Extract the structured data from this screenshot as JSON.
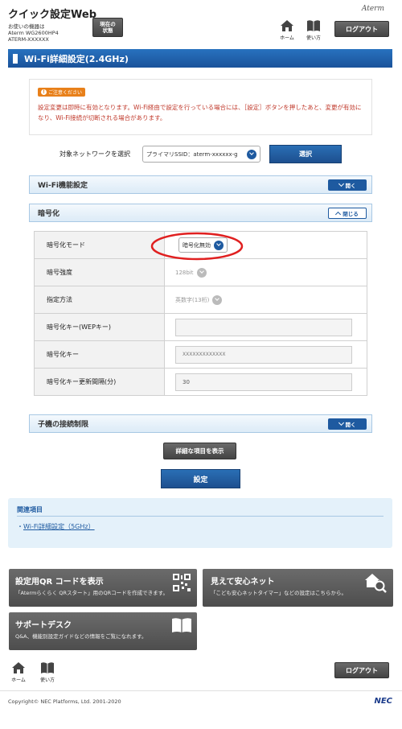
{
  "header": {
    "title": "クイック設定Web",
    "device_label": "お使いの機器は",
    "device_model": "Aterm WG2600HP4",
    "device_name": "ATERM-XXXXXX",
    "status_button": "現在の状態",
    "home_label": "ホーム",
    "help_label": "使い方",
    "logout_label": "ログアウト",
    "brand": "Aterm"
  },
  "page_title": "Wi-Fi詳細設定(2.4GHz)",
  "notice": {
    "badge": "ご注意ください",
    "text": "設定変更は即時に有効となります。Wi-Fi経由で設定を行っている場合には、［設定］ボタンを押したあと、変更が有効になり、Wi-Fi接続が切断される場合があります。"
  },
  "network_select": {
    "label": "対象ネットワークを選択",
    "value": "プライマリSSID：aterm-xxxxxx-g",
    "button": "選択"
  },
  "sections": {
    "wifi_function": {
      "title": "Wi-Fi機能設定",
      "toggle": "開く"
    },
    "encryption": {
      "title": "暗号化",
      "toggle": "閉じる"
    },
    "client_limit": {
      "title": "子機の接続制限",
      "toggle": "開く"
    }
  },
  "encryption_rows": [
    {
      "label": "暗号化モード",
      "value": "暗号化無効"
    },
    {
      "label": "暗号強度",
      "value": "128bit"
    },
    {
      "label": "指定方法",
      "value": "英数字(13桁)"
    },
    {
      "label": "暗号化キー(WEPキー)",
      "value": ""
    },
    {
      "label": "暗号化キー",
      "value": "XXXXXXXXXXXXX"
    },
    {
      "label": "暗号化キー更新間隔(分)",
      "value": "30"
    }
  ],
  "buttons": {
    "show_detail": "詳細な項目を表示",
    "apply": "設定"
  },
  "related": {
    "title": "関連項目",
    "link": "Wi-Fi詳細設定（5GHz）"
  },
  "cards": {
    "qr": {
      "title": "設定用QR コードを表示",
      "desc": "「Atermらくらく QRスタート」用のQRコードを作成できます。"
    },
    "safety": {
      "title": "見えて安心ネット",
      "desc": "「こども安心ネットタイマー」などの設定はこちらから。"
    },
    "support": {
      "title": "サポートデスク",
      "desc": "Q&A、機能別設定ガイドなどの情報をご覧になれます。"
    }
  },
  "footer": {
    "home_label": "ホーム",
    "help_label": "使い方",
    "logout_label": "ログアウト",
    "copyright": "Copyright© NEC Platforms, Ltd. 2001-2020",
    "brand": "NEC"
  },
  "colors": {
    "accent_blue": "#1e5aa0",
    "notice_red": "#c0392b",
    "badge_orange": "#e8801a",
    "highlight_red": "#e02020"
  }
}
